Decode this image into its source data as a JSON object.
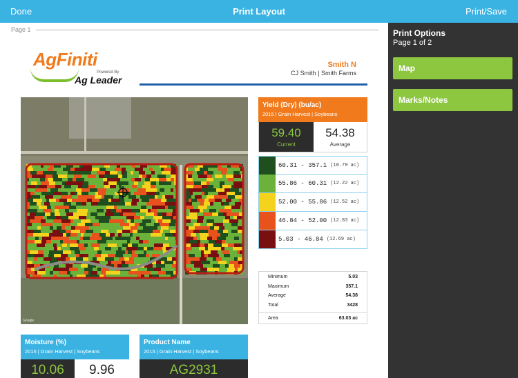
{
  "navbar": {
    "done_label": "Done",
    "title": "Print Layout",
    "print_save_label": "Print/Save"
  },
  "page": {
    "page_label": "Page 1",
    "logo": {
      "brand_main": "AgFiniti",
      "powered_by": "Powered By",
      "brand_sub": "Ag Leader"
    },
    "user": {
      "name": "Smith N",
      "farm": "CJ Smith | Smith Farms"
    },
    "yield_card": {
      "title": "Yield (Dry) (bu/ac)",
      "subtitle": "2015 | Grain Harvest | Soybeans",
      "current_value": "59.40",
      "current_label": "Current",
      "average_value": "54.38",
      "average_label": "Average",
      "legend": [
        {
          "color": "#1f4f1f",
          "range": "60.31 - 357.1",
          "acres": "(10.79 ac)"
        },
        {
          "color": "#6ab23a",
          "range": "55.86 - 60.31",
          "acres": "(12.22 ac)"
        },
        {
          "color": "#f5d21c",
          "range": "52.00 - 55.86",
          "acres": "(12.52 ac)"
        },
        {
          "color": "#e8521d",
          "range": "46.84 - 52.00",
          "acres": "(12.83 ac)"
        },
        {
          "color": "#7a0f12",
          "range": "5.03 - 46.84",
          "acres": "(12.69 ac)"
        }
      ]
    },
    "summary": [
      {
        "label": "Minimum",
        "value": "5.03"
      },
      {
        "label": "Maximum",
        "value": "357.1"
      },
      {
        "label": "Average",
        "value": "54.38"
      },
      {
        "label": "Total",
        "value": "3428"
      },
      {
        "label": "Area",
        "value": "63.03 ac"
      }
    ],
    "moisture_card": {
      "title": "Moisture (%)",
      "subtitle": "2015 | Grain Harvest | Soybeans",
      "current_value": "10.06",
      "average_value": "9.96"
    },
    "product_card": {
      "title": "Product Name",
      "subtitle": "2015 | Grain Harvest | Soybeans",
      "value": "AG2931"
    },
    "map": {
      "attribution": "Google"
    }
  },
  "sidebar": {
    "title": "Print Options",
    "page_indicator": "Page 1 of 2",
    "buttons": [
      {
        "label": "Map"
      },
      {
        "label": "Marks/Notes"
      }
    ]
  }
}
